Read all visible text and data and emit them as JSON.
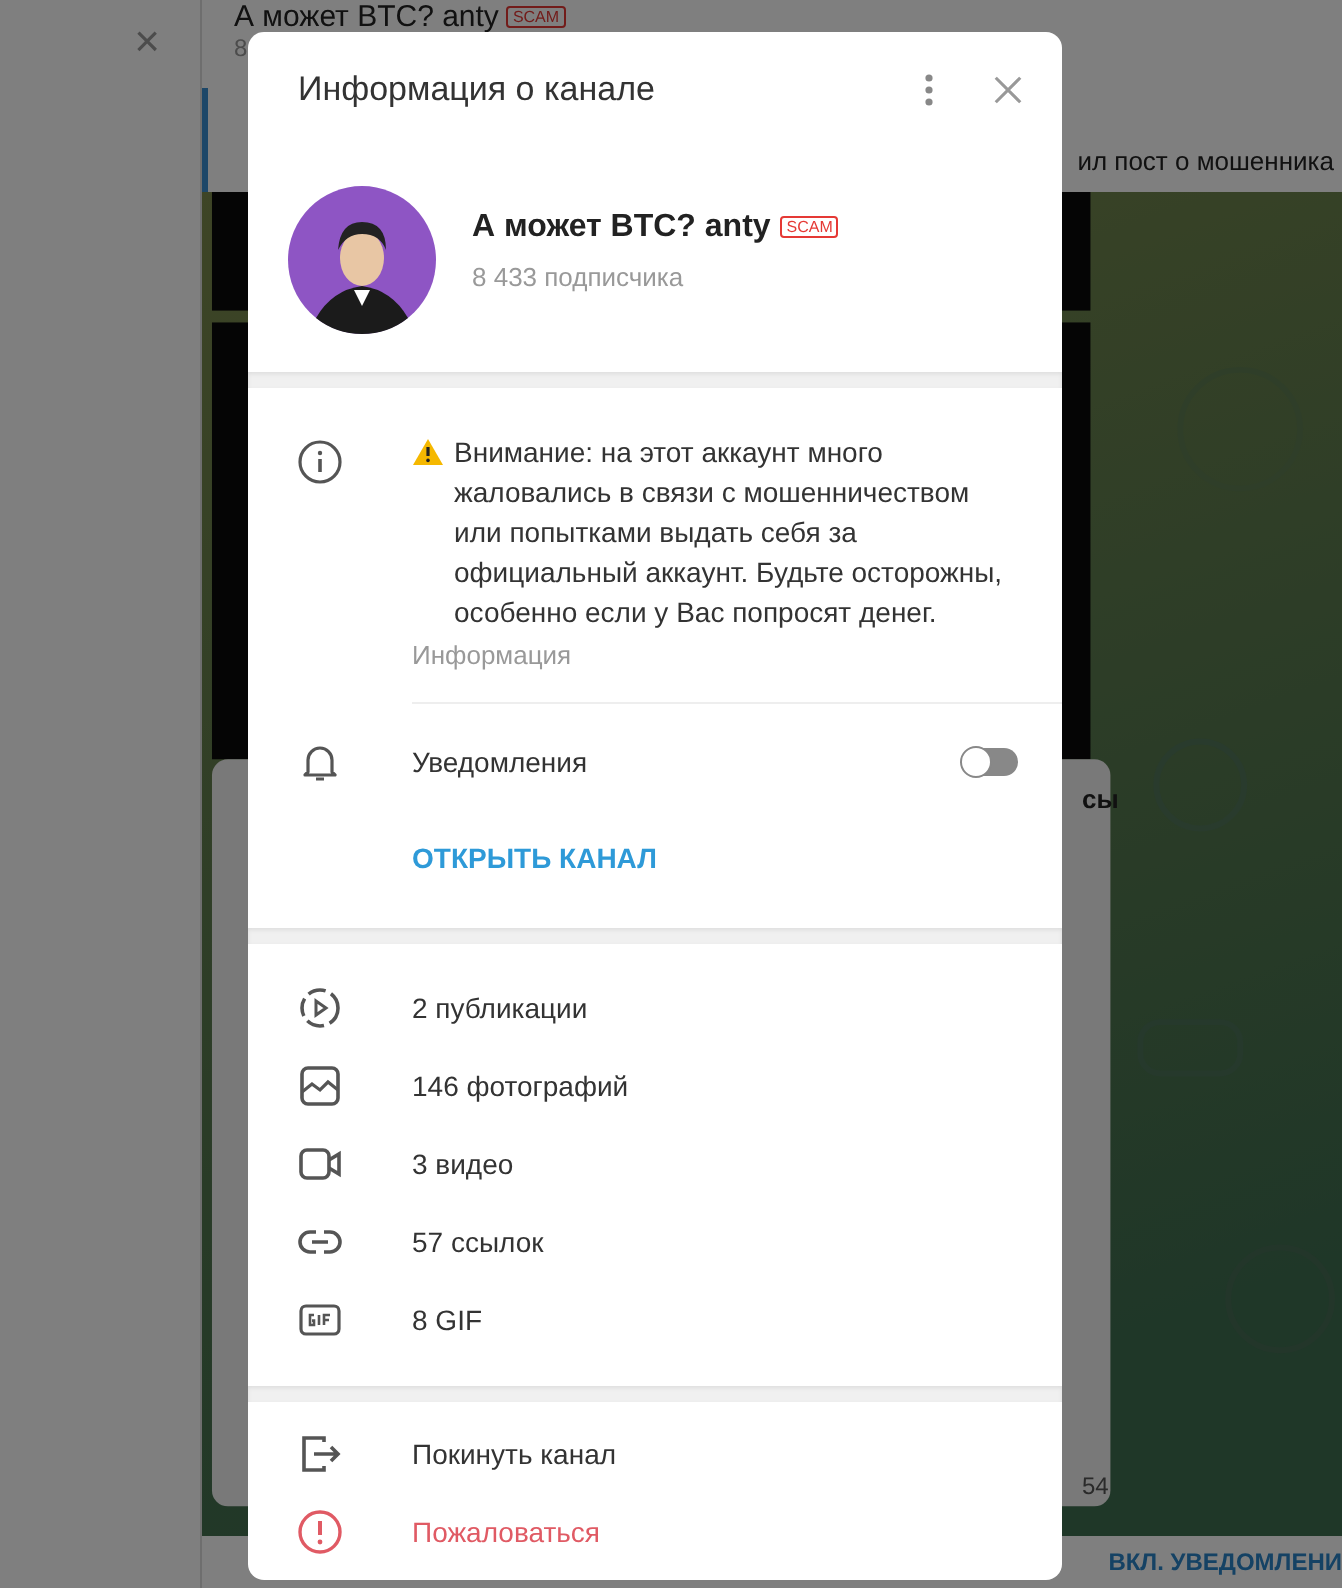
{
  "background": {
    "search_close": "×",
    "chat_title": "А может BTC? anty",
    "chat_badge": "SCAM",
    "chat_subtitle": "8",
    "pinned_text": "ил пост о мошенника",
    "message_fragments": [
      "сы",
      "54"
    ],
    "bottom_button": "ВКЛ. УВЕДОМЛЕНИ"
  },
  "dialog": {
    "title": "Информация о канале",
    "channel": {
      "name": "А может BTC? anty",
      "badge": "SCAM",
      "subscribers": "8 433 подписчика"
    },
    "info": {
      "text": "Внимание: на этот аккаунт много жаловались в связи с мошенничеством или попытками выдать себя за официальный аккаунт. Будьте осторожны, особенно если у Вас попросят денег.",
      "caption": "Информация"
    },
    "notifications": {
      "label": "Уведомления",
      "on": false
    },
    "open_link": "ОТКРЫТЬ КАНАЛ",
    "media": [
      {
        "kind": "posts",
        "label": "2 публикации"
      },
      {
        "kind": "photos",
        "label": "146 фотографий"
      },
      {
        "kind": "videos",
        "label": "3 видео"
      },
      {
        "kind": "links",
        "label": "57 ссылок"
      },
      {
        "kind": "gif",
        "label": "8 GIF"
      }
    ],
    "actions": [
      {
        "kind": "leave",
        "label": "Покинуть канал"
      },
      {
        "kind": "report",
        "label": "Пожаловаться"
      }
    ]
  }
}
